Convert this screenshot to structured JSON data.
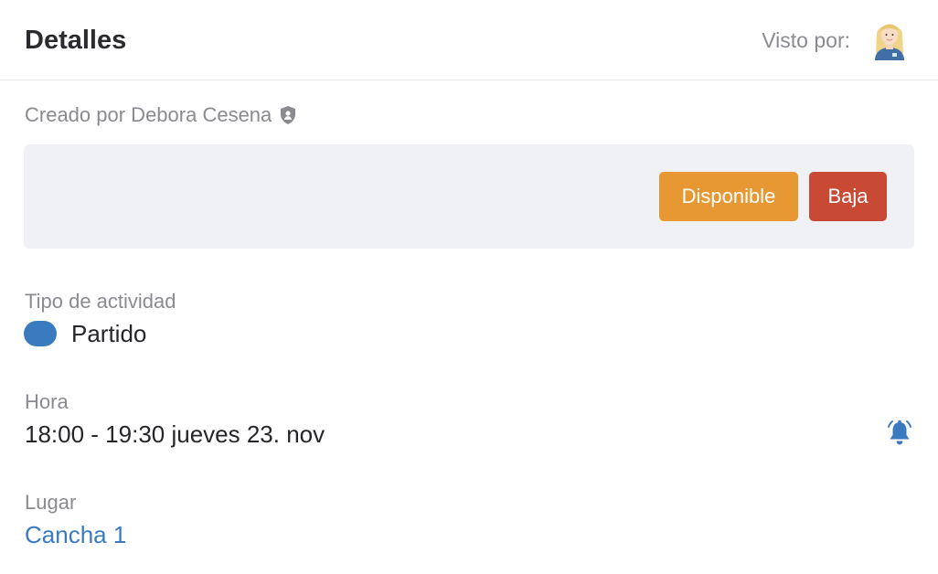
{
  "header": {
    "title": "Detalles",
    "seen_by_label": "Visto por:",
    "avatar_icon": "user-avatar-blonde"
  },
  "created": {
    "text": "Creado por Debora Cesena",
    "icon": "shield-icon"
  },
  "actions": {
    "available_label": "Disponible",
    "available_color": "#e89833",
    "drop_label": "Baja",
    "drop_color": "#c94a34"
  },
  "activity": {
    "label": "Tipo de actividad",
    "value": "Partido",
    "color": "#3a7bbf"
  },
  "time": {
    "label": "Hora",
    "value": "18:00 - 19:30 jueves 23. nov",
    "icon": "bell-icon"
  },
  "place": {
    "label": "Lugar",
    "value": "Cancha 1"
  }
}
